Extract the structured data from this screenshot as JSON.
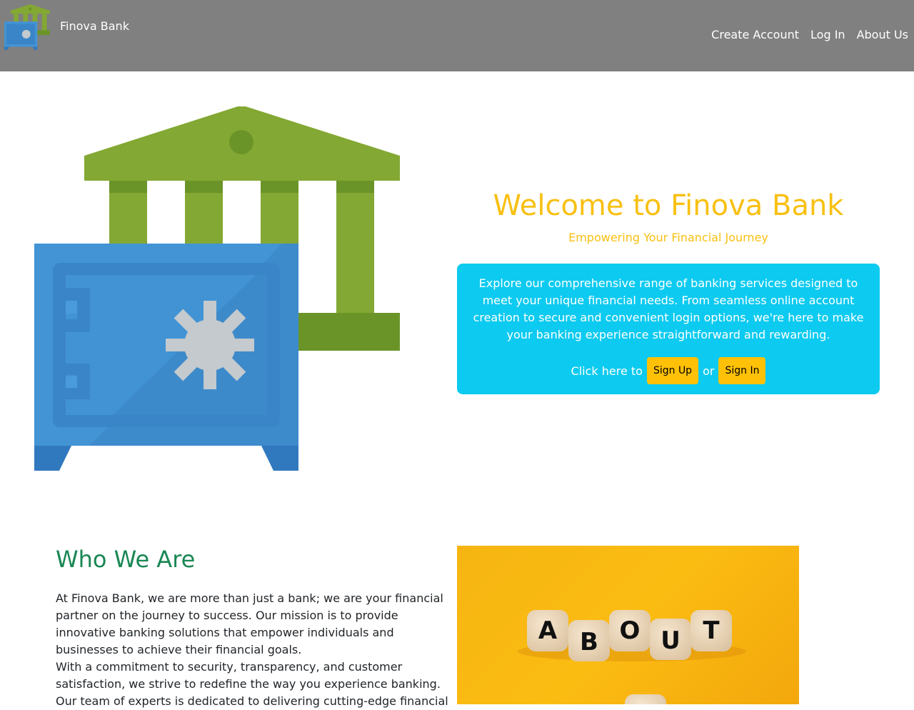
{
  "header": {
    "brand": "Finova Bank",
    "nav": [
      "Create Account",
      "Log In",
      "About Us"
    ]
  },
  "hero": {
    "title": "Welcome to Finova Bank",
    "subtitle": "Empowering Your Financial Journey",
    "description": "Explore our comprehensive range of banking services designed to meet your unique financial needs. From seamless online account creation to secure and convenient login options, we're here to make your banking experience straightforward and rewarding.",
    "cta_prefix": "Click here to",
    "cta_join": "or",
    "signup_label": "Sign Up",
    "signin_label": "Sign In"
  },
  "about": {
    "title": "Who We Are",
    "paragraphs": [
      "At Finova Bank, we are more than just a bank; we are your financial partner on the journey to success. Our mission is to provide innovative banking solutions that empower individuals and businesses to achieve their financial goals.",
      "With a commitment to security, transparency, and customer satisfaction, we strive to redefine the way you experience banking. Our team of experts is dedicated to delivering cutting-edge financial"
    ],
    "image_letters": [
      "A",
      "B",
      "O",
      "U",
      "T"
    ]
  },
  "colors": {
    "navbar": "#808080",
    "accent_yellow": "#f8c012",
    "card_cyan": "#0dcaf0",
    "button_yellow": "#ffc107",
    "about_green": "#198754",
    "bank_green": "#83a833",
    "safe_blue": "#4294d5"
  }
}
